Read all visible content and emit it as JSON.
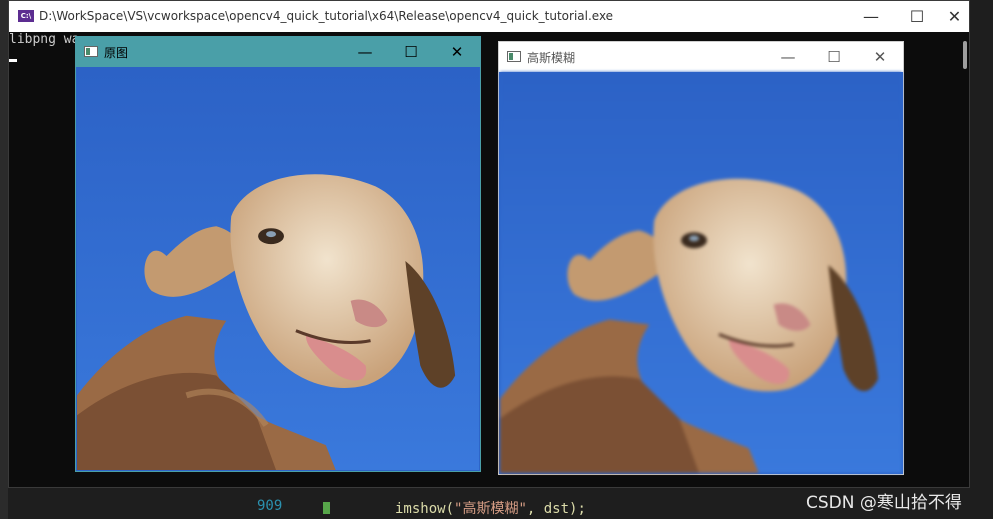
{
  "console": {
    "title": "D:\\WorkSpace\\VS\\vcworkspace\\opencv4_quick_tutorial\\x64\\Release\\opencv4_quick_tutorial.exe",
    "output_line": "libpng wa",
    "icon": "console-app-icon",
    "buttons": {
      "minimize": "—",
      "maximize": "☐",
      "close": "✕"
    }
  },
  "window_original": {
    "title": "原图",
    "buttons": {
      "minimize": "—",
      "maximize": "☐",
      "close": "✕"
    }
  },
  "window_blur": {
    "title": "高斯模糊",
    "buttons": {
      "minimize": "—",
      "maximize": "☐",
      "close": "✕"
    }
  },
  "editor": {
    "line_number": "909",
    "code_prefix": "imshow(",
    "code_string": "\"高斯模糊\"",
    "code_suffix": ", dst);"
  },
  "watermark": "CSDN @寒山拾不得",
  "colors": {
    "sky": "#2f67cc",
    "wool": "#c9a27a",
    "face": "#e7d3b8"
  }
}
